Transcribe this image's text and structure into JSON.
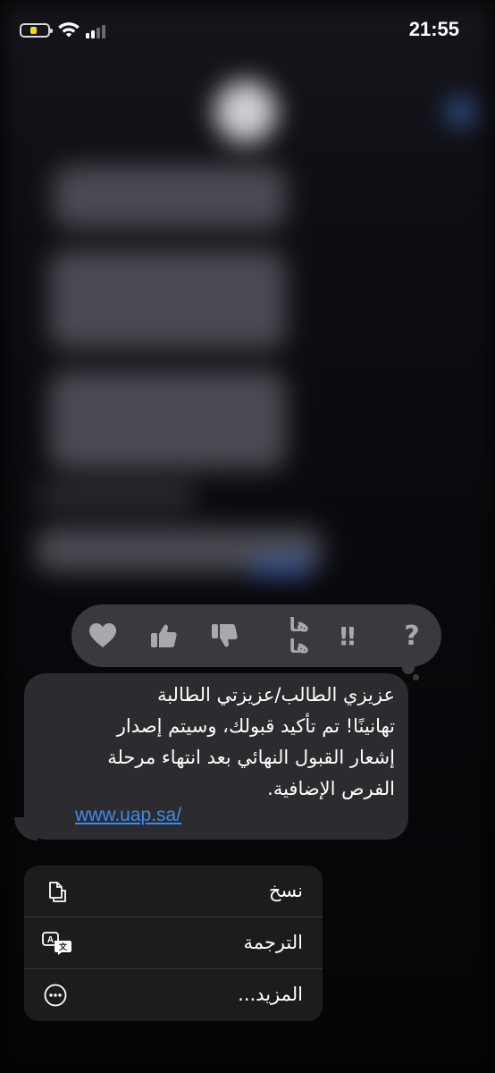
{
  "status_bar": {
    "time": "21:55"
  },
  "reactions": [
    {
      "name": "heart-icon",
      "label": ""
    },
    {
      "name": "thumbs-up-icon",
      "label": ""
    },
    {
      "name": "thumbs-down-icon",
      "label": ""
    },
    {
      "name": "haha-reaction",
      "label": "ها ها"
    },
    {
      "name": "exclamation-icon",
      "label": "‼"
    },
    {
      "name": "question-icon",
      "label": "?"
    }
  ],
  "message": {
    "lines": [
      "عزيزي الطالب/عزيزتي الطالبة",
      "تهانينًا! تم تأكيد قبولك، وسيتم إصدار",
      "إشعار القبول النهائي بعد انتهاء مرحلة",
      "الفرص الإضافية."
    ],
    "link": "www.uap.sa/"
  },
  "menu": {
    "items": [
      {
        "label": "نسخ",
        "icon": "copy-icon"
      },
      {
        "label": "الترجمة",
        "icon": "translate-icon"
      },
      {
        "label": "المزيد...",
        "icon": "more-icon"
      }
    ]
  },
  "colors": {
    "link": "#3a8bf0",
    "bubble": "#2c2c30",
    "reaction_bar": "#3a3a3e",
    "menu": "#1c1c1e",
    "battery_low": "#ffd60a"
  }
}
